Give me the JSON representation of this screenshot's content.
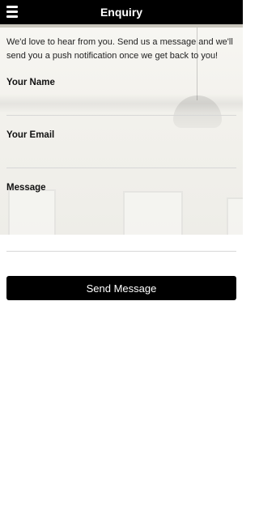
{
  "header": {
    "title": "Enquiry",
    "menu_icon": "hamburger-menu-icon"
  },
  "intro_text": "We'd love to hear from you. Send us a message and we'll send you a push notification once we get back to you!",
  "form": {
    "name": {
      "label": "Your Name",
      "value": "",
      "placeholder": ""
    },
    "email": {
      "label": "Your Email",
      "value": "",
      "placeholder": ""
    },
    "message": {
      "label": "Message",
      "value": "",
      "placeholder": ""
    },
    "submit_label": "Send Message"
  },
  "colors": {
    "header_bg": "#000000",
    "button_bg": "#000000",
    "text": "#111111"
  }
}
